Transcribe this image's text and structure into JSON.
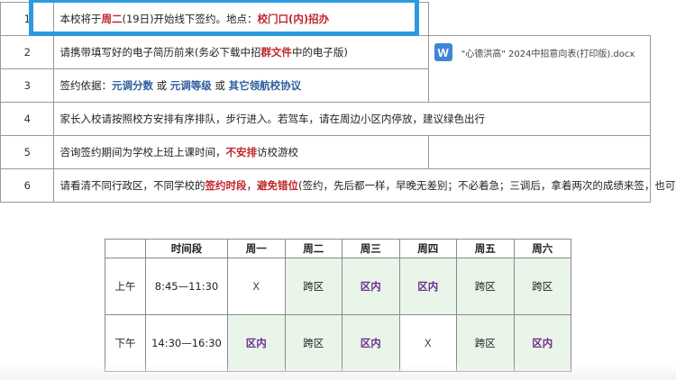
{
  "notice_rows": [
    {
      "num": "1",
      "parts": [
        {
          "text": "本校将于",
          "style": "plain"
        },
        {
          "text": "周二",
          "style": "red"
        },
        {
          "text": "(19日)开始线下签约。地点：",
          "style": "plain"
        },
        {
          "text": "校门口(内)招办",
          "style": "red"
        }
      ]
    },
    {
      "num": "2",
      "parts": [
        {
          "text": "请携带填写好的电子简历前来(务必下载中招",
          "style": "plain"
        },
        {
          "text": "群文件",
          "style": "red"
        },
        {
          "text": "中的电子版)",
          "style": "plain"
        }
      ]
    },
    {
      "num": "3",
      "parts": [
        {
          "text": "签约依据：",
          "style": "plain"
        },
        {
          "text": "元调分数",
          "style": "blue"
        },
        {
          "text": "  或  ",
          "style": "plain"
        },
        {
          "text": "元调等级",
          "style": "blue"
        },
        {
          "text": "  或  ",
          "style": "plain"
        },
        {
          "text": "其它领航校协议",
          "style": "blue"
        }
      ]
    },
    {
      "num": "4",
      "parts": [
        {
          "text": "家长入校请按照校方安排有序排队，步行进入。若驾车，请在周边小区内停放，建议绿色出行",
          "style": "plain"
        }
      ]
    },
    {
      "num": "5",
      "parts": [
        {
          "text": "咨询签约期间为学校上班上课时间，",
          "style": "plain"
        },
        {
          "text": "不安排",
          "style": "red"
        },
        {
          "text": "访校游校",
          "style": "plain"
        }
      ]
    },
    {
      "num": "6",
      "parts": [
        {
          "text": "请看清不同行政区，不同学校的",
          "style": "plain"
        },
        {
          "text": "签约时段",
          "style": "red"
        },
        {
          "text": "，",
          "style": "plain"
        },
        {
          "text": "避免错位",
          "style": "red"
        },
        {
          "text": "(签约，先后都一样，早晚无差别；不必着急；三调后，拿着两次的成绩来签，也可行)",
          "style": "plain"
        }
      ]
    }
  ],
  "attachment": {
    "icon_letter": "W",
    "filename": "\"心德洪高\" 2024中招意向表(打印版).docx"
  },
  "schedule": {
    "headers": [
      "",
      "时间段",
      "周一",
      "周二",
      "周三",
      "周四",
      "周五",
      "周六"
    ],
    "rows": [
      {
        "period": "上午",
        "time": "8:45—11:30",
        "cells": [
          "X",
          "跨区",
          "区内",
          "区内",
          "跨区",
          "跨区"
        ]
      },
      {
        "period": "下午",
        "time": "14:30—16:30",
        "cells": [
          "区内",
          "跨区",
          "区内",
          "X",
          "跨区",
          "区内"
        ]
      }
    ]
  },
  "colors": {
    "highlight": "#2a9be0",
    "red_text": "#c0262c",
    "blue_text": "#2f5e9e",
    "purple_text": "#6b2f8e",
    "green_cell": "#eaf5e9"
  }
}
